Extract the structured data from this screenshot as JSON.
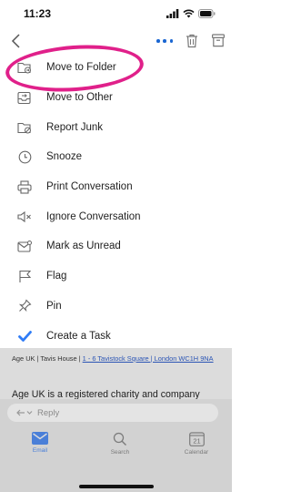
{
  "status": {
    "time": "11:23",
    "icons": [
      "signal-icon",
      "wifi-icon",
      "battery-icon"
    ]
  },
  "toolbar": {
    "back_icon": "chevron-left-icon",
    "more_icon": "ellipsis-icon",
    "delete_icon": "trash-icon",
    "archive_icon": "archive-icon"
  },
  "menu": {
    "items": [
      {
        "label": "Move to Folder",
        "icon": "folder-move-icon"
      },
      {
        "label": "Move to Other",
        "icon": "inbox-move-icon"
      },
      {
        "label": "Report Junk",
        "icon": "folder-block-icon"
      },
      {
        "label": "Snooze",
        "icon": "clock-icon"
      },
      {
        "label": "Print Conversation",
        "icon": "printer-icon"
      },
      {
        "label": "Ignore Conversation",
        "icon": "mute-icon"
      },
      {
        "label": "Mark as Unread",
        "icon": "envelope-icon"
      },
      {
        "label": "Flag",
        "icon": "flag-icon"
      },
      {
        "label": "Pin",
        "icon": "pin-icon"
      },
      {
        "label": "Create a Task",
        "icon": "checkmark-icon"
      }
    ]
  },
  "email": {
    "footer_prefix": "Age UK | Tavis House | ",
    "footer_link": "1 - 6 Tavistock Square | London WC1H 9NA",
    "body": "Age UK is a registered charity and company limited by guarantee, (registered charity number"
  },
  "reply": {
    "label": "Reply",
    "icon": "reply-icon"
  },
  "tabs": [
    {
      "label": "Email",
      "icon": "envelope-icon",
      "active": true
    },
    {
      "label": "Search",
      "icon": "search-icon",
      "active": false
    },
    {
      "label": "Calendar",
      "icon": "calendar-icon",
      "active": false,
      "badge": "21"
    }
  ],
  "colors": {
    "accent": "#1a66d2",
    "highlight": "#e0208a",
    "task_check": "#2f7cf6"
  }
}
